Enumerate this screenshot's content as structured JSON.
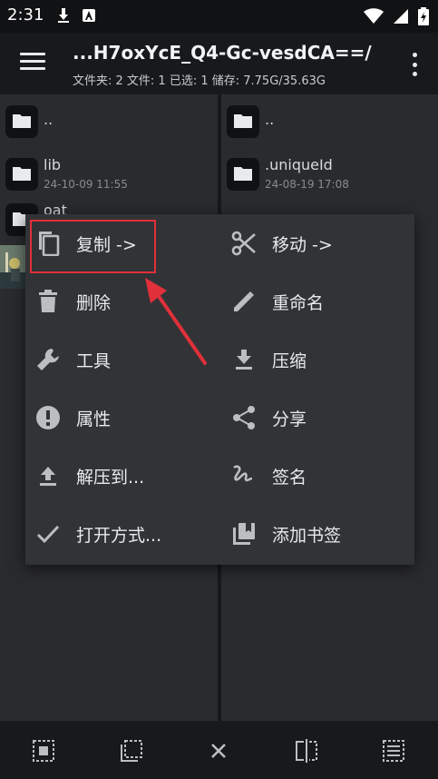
{
  "status_bar": {
    "time": "2:31"
  },
  "app_bar": {
    "title": "...H7oxYcE_Q4-Gc-vesdCA==/",
    "subtitle": "文件夹: 2  文件: 1  已选: 1  储存: 7.75G/35.63G"
  },
  "left_pane": {
    "items": [
      {
        "name": "..",
        "date": ""
      },
      {
        "name": "lib",
        "date": "24-10-09 11:55"
      },
      {
        "name": "oat",
        "date": ""
      }
    ]
  },
  "right_pane": {
    "items": [
      {
        "name": "..",
        "date": ""
      },
      {
        "name": ".uniqueId",
        "date": "24-08-19 17:08"
      }
    ]
  },
  "context_menu": {
    "items": [
      {
        "label": "复制 ->",
        "icon": "copy-icon"
      },
      {
        "label": "移动 ->",
        "icon": "scissors-icon"
      },
      {
        "label": "删除",
        "icon": "trash-icon"
      },
      {
        "label": "重命名",
        "icon": "pencil-icon"
      },
      {
        "label": "工具",
        "icon": "wrench-icon"
      },
      {
        "label": "压缩",
        "icon": "download-icon"
      },
      {
        "label": "属性",
        "icon": "info-icon"
      },
      {
        "label": "分享",
        "icon": "share-icon"
      },
      {
        "label": "解压到...",
        "icon": "upload-icon"
      },
      {
        "label": "签名",
        "icon": "signature-icon"
      },
      {
        "label": "打开方式...",
        "icon": "check-icon"
      },
      {
        "label": "添加书签",
        "icon": "bookmark-icon"
      }
    ]
  },
  "bottom_bar": {
    "icons": [
      "select-all-icon",
      "select-inverse-icon",
      "close-icon",
      "compare-icon",
      "select-range-icon"
    ]
  },
  "colors": {
    "accent": "#e0303a",
    "background": "#202124",
    "dialog": "#323336"
  }
}
